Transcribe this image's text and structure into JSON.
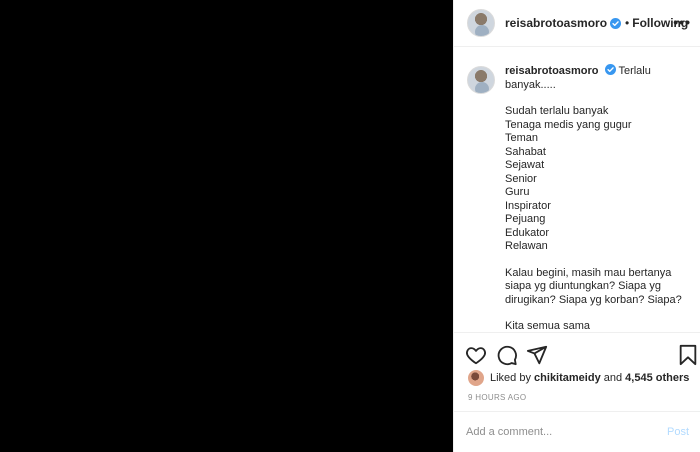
{
  "header": {
    "username": "reisabrotoasmoro",
    "separator": "•",
    "follow_label": "Following",
    "more_label": "•••"
  },
  "caption": {
    "username": "reisabrotoasmoro",
    "first": "Terlalu banyak.....",
    "lines": [
      "Sudah terlalu banyak",
      "Tenaga medis yang gugur",
      "Teman",
      "Sahabat",
      "Sejawat",
      "Senior",
      "Guru",
      "Inspirator",
      "Pejuang",
      "Edukator",
      "Relawan"
    ],
    "paragraph": "Kalau begini, masih mau bertanya siapa yg diuntungkan? Siapa yg dirugikan? Siapa yg korban? Siapa?",
    "last": "Kita semua sama"
  },
  "likes": {
    "prefix": "Liked by",
    "liker": "chikitameidy",
    "and": "and",
    "others": "4,545 others"
  },
  "timestamp": "9 HOURS AGO",
  "comment": {
    "placeholder": "Add a comment...",
    "post_label": "Post"
  },
  "colors": {
    "verified": "#3897f0",
    "post_disabled": "#b3dbff",
    "media_bg": "#000000"
  },
  "icons": [
    "heart-icon",
    "comment-icon",
    "share-icon",
    "bookmark-icon",
    "verified-icon"
  ]
}
